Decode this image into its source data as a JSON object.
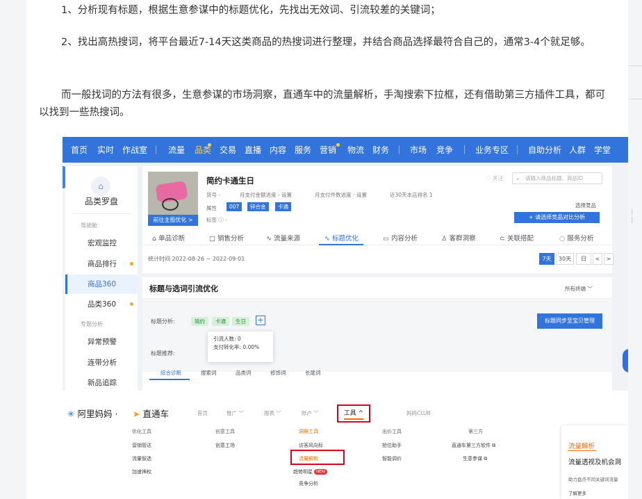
{
  "article": {
    "p1": "1、分析现有标题，根据生意参谋中的标题优化，先找出无效词、引流较差的关键词；",
    "p2": "2、找出高热搜词，将平台最近7-14天这类商品的热搜词进行整理，并结合商品选择最符合自己的，通常3-4个就足够。",
    "p3": "而一般找词的方法有很多，生意参谋的市场洞察，直通车中的流量解析，手淘搜索下拉框，还有借助第三方插件工具，都可以找到一些热搜词。"
  },
  "shot1": {
    "nav": [
      "首页",
      "实时",
      "作战室",
      "流量",
      "品类",
      "交易",
      "直播",
      "内容",
      "服务",
      "营销",
      "物流",
      "财务",
      "市场",
      "竞争",
      "业务专区",
      "自助分析",
      "人群",
      "学堂"
    ],
    "active_nav": "品类",
    "left": {
      "title": "品类罗盘",
      "sec1": "驾驶舱",
      "items1": [
        "宏观监控",
        "商品排行",
        "商品360",
        "品类360"
      ],
      "sec2": "专题分析",
      "items2": [
        "异常预警",
        "连带分析",
        "新品追踪"
      ],
      "active": "商品360"
    },
    "product": {
      "name": "简约卡通生日",
      "btn": "前往主图优化 >",
      "meta1": [
        "货号 -",
        "月支付金额进度 -  设置",
        "月支付件数进度 -  设置",
        "近30天本店排名 1"
      ],
      "attr_label": "属性",
      "tags": [
        "007",
        "锌合金",
        "卡通"
      ],
      "mark": "标签 ⓘ  -"
    },
    "fav": "♡ 关注",
    "search_placeholder": "请输入商品标题、商品ID",
    "choose": "选择竞品",
    "compare_btn": "+ 请选择竞品对比分析",
    "tabs": [
      "单品诊断",
      "销售分析",
      "流量来源",
      "标题优化",
      "内容分析",
      "客群洞察",
      "关联搭配",
      "服务分析"
    ],
    "tab_icons": [
      "⌂",
      "□",
      "∿",
      "∿",
      "▭",
      "♙",
      "⊂",
      "◌"
    ],
    "active_tab": "标题优化",
    "date": "统计时间 2022-08-26 ~ 2022-09-01",
    "periods": [
      "7天",
      "30天",
      "日",
      "<",
      ">"
    ],
    "section_title": "标题与选词引流优化",
    "all_terminal": "所有终端  ﹀",
    "title_analysis_label": "标题分析:",
    "title_tags": [
      "简约",
      "卡通",
      "生日"
    ],
    "tip_lines": [
      "引流人数: 0",
      "支付转化率: 0.00%"
    ],
    "sync_btn": "标题同步至宝贝管理",
    "recommend_label": "标题推荐:",
    "subtabs": [
      "综合诊断",
      "搜索词",
      "品类词",
      "修饰词",
      "长尾词"
    ]
  },
  "shot2": {
    "brand": "阿里妈妈",
    "product": "直通车",
    "nav": [
      "首页",
      "推广 ﹀",
      "报表 ﹀",
      "账户 ﹀",
      "工具 ^",
      "妈妈CLUB"
    ],
    "cols": [
      [
        "优化工具",
        "营销管达",
        "流量智选",
        "加速神权"
      ],
      [
        "创意工具",
        "创意工场"
      ],
      [
        "洞察工具",
        "访客风向标",
        "流量解析",
        "趋势明星"
      ],
      [
        "出价工具",
        "抢位助手",
        "智能调价"
      ],
      [
        "第三方",
        "直通车第三方软件 ⧉",
        "生意参谋 ⧉"
      ]
    ],
    "extra": "竞争分析",
    "new_badge": "NEW",
    "popup": {
      "title": "流量解析",
      "subtitle": "流量透视及机会洞",
      "desc": "助力盘点不同关键词流量",
      "more": "了解更多"
    }
  },
  "colors": {
    "brand_blue": "#3273dc",
    "alert_red": "#d9001b",
    "orange": "#ff6a00"
  }
}
